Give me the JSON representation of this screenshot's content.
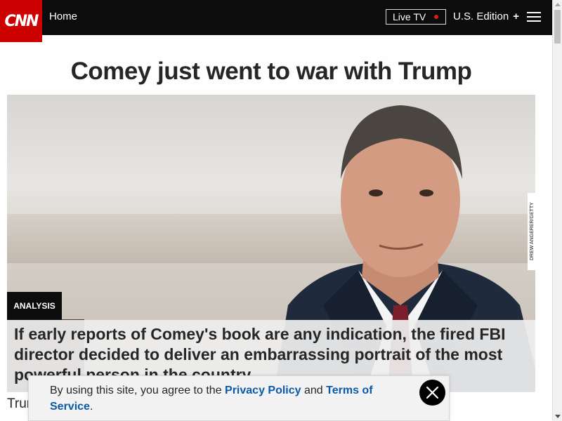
{
  "nav": {
    "logo": "CNN",
    "home": "Home",
    "live_tv": "Live TV",
    "edition": "U.S. Edition",
    "edition_icon": "+",
    "menu_icon": "hamburger-menu-icon"
  },
  "article": {
    "headline": "Comey just went to war with Trump",
    "photo_credit": "DREW ANGERER/GETTY IMAGES",
    "tag": "ANALYSIS",
    "subhead": "If early reports of Comey's book are any indication, the fired FBI director decided to deliver an embarrassing portrait of the most powerful person in the country",
    "body_start": "Trum"
  },
  "cookie_banner": {
    "text_before": "By using this site, you agree to the ",
    "privacy_link": "Privacy Policy",
    "text_and": " and ",
    "terms_link": "Terms of Service",
    "text_end": ".",
    "close_icon": "close-icon"
  },
  "colors": {
    "brand_red": "#cc0000",
    "nav_bg": "#0c0c0c",
    "link_blue": "#0b5aa6",
    "live_dot": "#e21b1b"
  }
}
